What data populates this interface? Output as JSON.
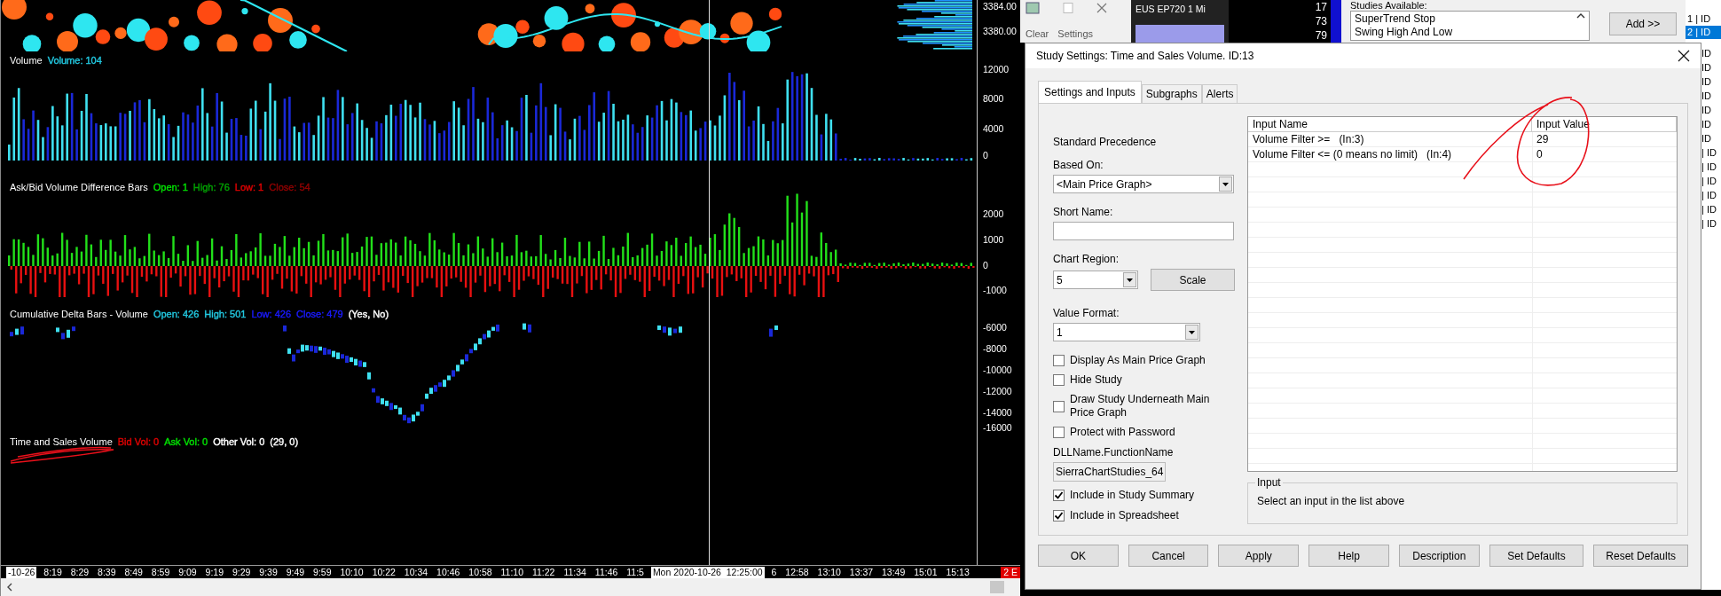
{
  "chart": {
    "panes": [
      {
        "kind": "price",
        "axis_labels": [
          "3384.00",
          "3380.00"
        ]
      },
      {
        "kind": "volume",
        "title": "Volume",
        "values": [
          {
            "text": "Volume: 104",
            "color": "#22c8e0"
          }
        ],
        "axis_labels": [
          "12000",
          "8000",
          "4000",
          "0"
        ]
      },
      {
        "kind": "difference",
        "title": "Ask/Bid Volume Difference Bars",
        "values": [
          {
            "text": "Open: 1",
            "color": "#00e000"
          },
          {
            "text": "High: 76",
            "color": "#00a000"
          },
          {
            "text": "Low: 1",
            "color": "#e00000"
          },
          {
            "text": "Close: 54",
            "color": "#900000"
          }
        ],
        "axis_labels": [
          "2000",
          "1000",
          "0",
          "-1000"
        ]
      },
      {
        "kind": "delta",
        "title": "Cumulative Delta Bars - Volume",
        "values": [
          {
            "text": "Open: 426",
            "color": "#22c8e0"
          },
          {
            "text": "High: 501",
            "color": "#22c8e0"
          },
          {
            "text": "Low: 426",
            "color": "#1a1aff"
          },
          {
            "text": "Close: 479",
            "color": "#1a1aff"
          },
          {
            "text": "(Yes, No)",
            "color": "#ffffff"
          }
        ],
        "axis_labels": [
          "-6000",
          "-8000",
          "-10000",
          "-12000",
          "-14000",
          "-16000"
        ]
      },
      {
        "kind": "tns",
        "title": "Time and Sales Volume",
        "values": [
          {
            "text": "Bid Vol: 0",
            "color": "#e00000"
          },
          {
            "text": "Ask Vol: 0",
            "color": "#00e000"
          },
          {
            "text": "Other Vol: 0",
            "color": "#ffffff"
          },
          {
            "text": "(29, 0)",
            "color": "#ffffff"
          }
        ]
      }
    ],
    "time_axis": [
      {
        "text": "-10-26",
        "kind": "date"
      },
      {
        "text": "8:19",
        "kind": "tick"
      },
      {
        "text": "8:29",
        "kind": "tick"
      },
      {
        "text": "8:39",
        "kind": "tick"
      },
      {
        "text": "8:49",
        "kind": "tick"
      },
      {
        "text": "8:59",
        "kind": "tick"
      },
      {
        "text": "9:09",
        "kind": "tick"
      },
      {
        "text": "9:19",
        "kind": "tick"
      },
      {
        "text": "9:29",
        "kind": "tick"
      },
      {
        "text": "9:39",
        "kind": "tick"
      },
      {
        "text": "9:49",
        "kind": "tick"
      },
      {
        "text": "9:59",
        "kind": "tick"
      },
      {
        "text": "10:10",
        "kind": "tick"
      },
      {
        "text": "10:22",
        "kind": "tick"
      },
      {
        "text": "10:34",
        "kind": "tick"
      },
      {
        "text": "10:46",
        "kind": "tick"
      },
      {
        "text": "10:58",
        "kind": "tick"
      },
      {
        "text": "11:10",
        "kind": "tick"
      },
      {
        "text": "11:22",
        "kind": "tick"
      },
      {
        "text": "11:34",
        "kind": "tick"
      },
      {
        "text": "11:46",
        "kind": "tick"
      },
      {
        "text": "11:5",
        "kind": "tick"
      },
      {
        "text": "Mon 2020-10-26  12:25:00",
        "kind": "cursor"
      },
      {
        "text": "6",
        "kind": "tick"
      },
      {
        "text": "12:58",
        "kind": "tick"
      },
      {
        "text": "13:10",
        "kind": "tick"
      },
      {
        "text": "13:37",
        "kind": "tick"
      },
      {
        "text": "13:49",
        "kind": "tick"
      },
      {
        "text": "15:01",
        "kind": "tick"
      },
      {
        "text": "15:13",
        "kind": "tick"
      }
    ],
    "corner_label": "2 E"
  },
  "toolbar": {
    "buttons": [
      "Clear",
      "Settings"
    ]
  },
  "chart_title": "EUS EP720 1 Mi",
  "dom_numbers": [
    "17",
    "73",
    "79"
  ],
  "studies_available": {
    "label": "Studies Available:",
    "items": [
      "SuperTrend Stop",
      "Swing High And Low"
    ]
  },
  "add_button": "Add >>",
  "studies_to_graph": [
    {
      "text": "1 | ID",
      "selected": false
    },
    {
      "text": "2 | ID",
      "selected": true
    }
  ],
  "studies_to_graph_hidden": [
    "ID",
    "ID",
    "ID",
    "ID",
    "ID",
    "ID",
    "ID",
    "| ID",
    "| ID",
    "| ID",
    "| ID",
    "| ID",
    "| ID"
  ],
  "dialog": {
    "title": "Study Settings: Time and Sales Volume. ID:13",
    "tabs": [
      {
        "label": "Settings and Inputs",
        "selected": true
      },
      {
        "label": "Subgraphs",
        "selected": false
      },
      {
        "label": "Alerts",
        "selected": false
      }
    ],
    "standard_precedence": "Standard Precedence",
    "based_on": {
      "label": "Based On:",
      "value": "<Main Price Graph>"
    },
    "short_name": {
      "label": "Short Name:"
    },
    "chart_region": {
      "label": "Chart Region:",
      "value": "5"
    },
    "scale_button": "Scale",
    "value_format": {
      "label": "Value Format:",
      "value": "1"
    },
    "options": [
      {
        "label": "Display As Main Price Graph",
        "checked": false
      },
      {
        "label": "Hide Study",
        "checked": false
      },
      {
        "label": "Draw Study Underneath Main Price Graph",
        "checked": false
      },
      {
        "label": "Protect with Password",
        "checked": false
      }
    ],
    "dll": {
      "label": "DLLName.FunctionName",
      "value": "SierraChartStudies_64"
    },
    "summary_options": [
      {
        "label": "Include in Study Summary",
        "checked": true
      },
      {
        "label": "Include in Spreadsheet",
        "checked": true
      }
    ],
    "inputs_table": {
      "columns": [
        "Input Name",
        "Input Value"
      ],
      "rows": [
        {
          "name": "Volume Filter >=   (In:3)",
          "value": "29"
        },
        {
          "name": "Volume Filter <= (0 means no limit)   (In:4)",
          "value": "0"
        }
      ]
    },
    "input_group": {
      "label": "Input",
      "text": "Select an input in the list above"
    },
    "buttons": [
      "OK",
      "Cancel",
      "Apply",
      "Help",
      "Description",
      "Set Defaults",
      "Reset Defaults"
    ]
  }
}
